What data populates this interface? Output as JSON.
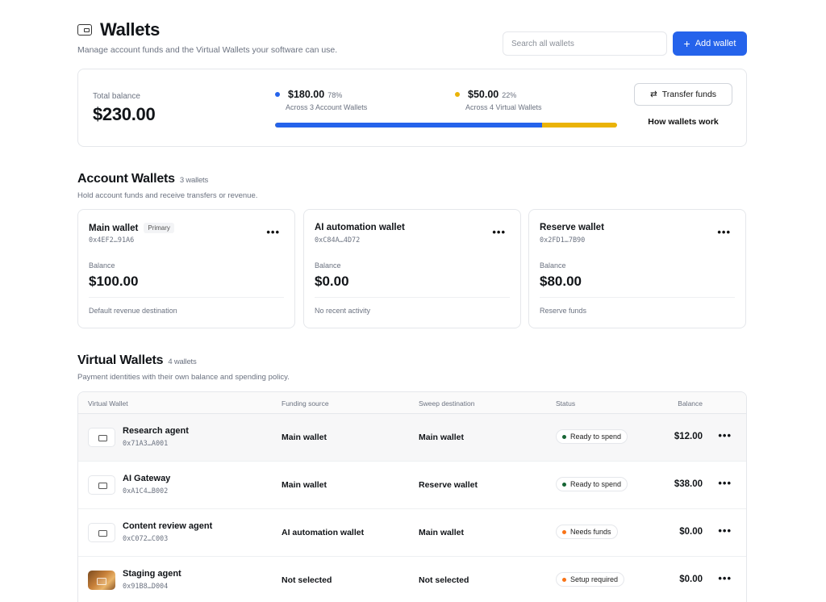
{
  "header": {
    "title": "Wallets",
    "subtitle": "Manage account funds and the Virtual Wallets your software can use.",
    "search_placeholder": "Search all wallets",
    "add_label": "Add wallet"
  },
  "summary": {
    "total_label": "Total balance",
    "total_value": "$230.00",
    "account": {
      "amount": "$180.00",
      "pct": "78%",
      "desc": "Across 3 Account Wallets",
      "fraction": 0.78,
      "color": "#2563eb"
    },
    "virtual": {
      "amount": "$50.00",
      "pct": "22%",
      "desc": "Across 4 Virtual Wallets",
      "color": "#eab308"
    },
    "transfer_label": "Transfer funds",
    "how_label": "How wallets work"
  },
  "account_wallets": {
    "title": "Account Wallets",
    "count": "3 wallets",
    "subtitle": "Hold account funds and receive transfers or revenue.",
    "items": [
      {
        "name": "Main wallet",
        "badge": "Primary",
        "address": "0x4EF2…91A6",
        "balance_label": "Balance",
        "balance": "$100.00",
        "footer": "Default revenue destination"
      },
      {
        "name": "AI automation wallet",
        "badge": "",
        "address": "0xC84A…4D72",
        "balance_label": "Balance",
        "balance": "$0.00",
        "footer": "No recent activity"
      },
      {
        "name": "Reserve wallet",
        "badge": "",
        "address": "0x2FD1…7B90",
        "balance_label": "Balance",
        "balance": "$80.00",
        "footer": "Reserve funds"
      }
    ]
  },
  "virtual_wallets": {
    "title": "Virtual Wallets",
    "count": "4 wallets",
    "subtitle": "Payment identities with their own balance and spending policy.",
    "columns": {
      "wallet": "Virtual Wallet",
      "funding": "Funding source",
      "sweep": "Sweep destination",
      "status": "Status",
      "balance": "Balance"
    },
    "rows": [
      {
        "name": "Research agent",
        "address": "0x71A3…A001",
        "funding": "Main wallet",
        "sweep": "Main wallet",
        "status": "Ready to spend",
        "status_color": "#166534",
        "balance": "$12.00",
        "icon": "wallet-icon"
      },
      {
        "name": "AI Gateway",
        "address": "0xA1C4…B002",
        "funding": "Main wallet",
        "sweep": "Reserve wallet",
        "status": "Ready to spend",
        "status_color": "#166534",
        "balance": "$38.00",
        "icon": "wallet-icon"
      },
      {
        "name": "Content review agent",
        "address": "0xC072…C003",
        "funding": "AI automation wallet",
        "sweep": "Main wallet",
        "status": "Needs funds",
        "status_color": "#f97316",
        "balance": "$0.00",
        "icon": "wallet-icon"
      },
      {
        "name": "Staging agent",
        "address": "0x91B8…D004",
        "funding": "Not selected",
        "sweep": "Not selected",
        "status": "Setup required",
        "status_color": "#f97316",
        "balance": "$0.00",
        "icon": "card-icon"
      }
    ]
  }
}
